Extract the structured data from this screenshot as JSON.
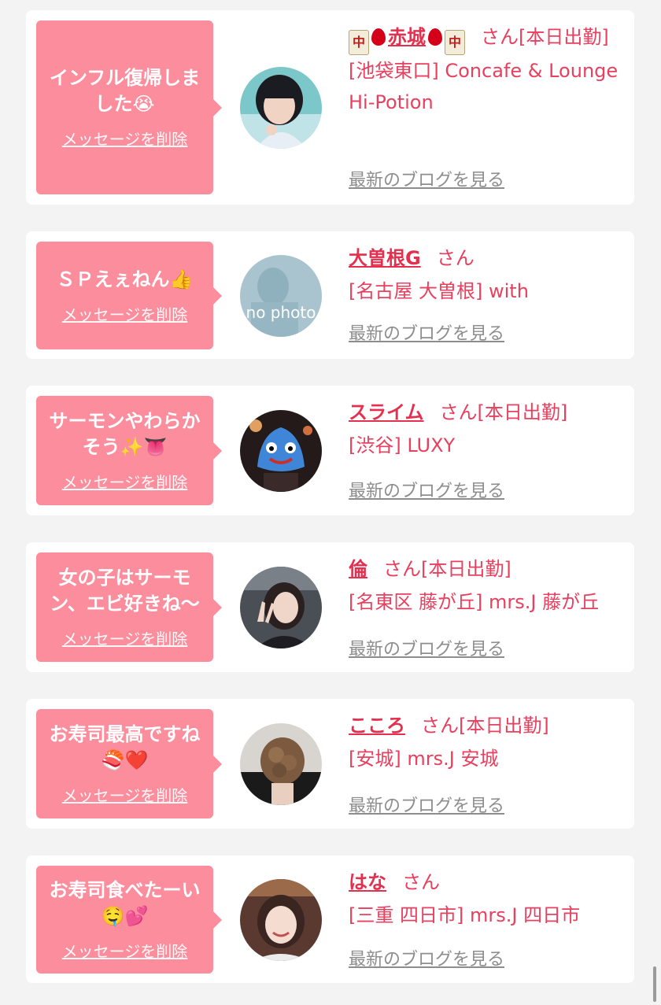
{
  "delete_label": "メッセージを削除",
  "blog_label": "最新のブログを見る",
  "san_label": "さん",
  "colors": {
    "bubble": "#fb8d9c",
    "accent": "#e3304f",
    "card": "#ffffff",
    "background": "#f3f3f3"
  },
  "cards": [
    {
      "message": "インフル復帰しました😭",
      "name": "赤城",
      "name_decor": [
        "mahjong-chun-icon",
        "blood-drop-icon"
      ],
      "status": "[本日出勤]",
      "shop": "[池袋東口] Concafe & Lounge Hi-Potion",
      "avatar": "photo-woman-short-black-hair"
    },
    {
      "message": "ＳＰえぇねん👍",
      "name": "大曽根G",
      "status": "",
      "shop": "[名古屋 大曽根] with",
      "avatar": "no photo"
    },
    {
      "message": "サーモンやわらかそう✨👅",
      "name": "スライム",
      "status": "[本日出勤]",
      "shop": "[渋谷] LUXY",
      "avatar": "photo-slime-mask"
    },
    {
      "message": "女の子はサーモン、エビ好きね〜",
      "name": "倫",
      "status": "[本日出勤]",
      "shop": "[名東区 藤が丘] mrs.J 藤が丘",
      "avatar": "photo-woman-peace-sign"
    },
    {
      "message": "お寿司最高ですね🍣❤️",
      "name": "こころ",
      "status": "[本日出勤]",
      "shop": "[安城] mrs.J 安城",
      "avatar": "photo-hair-updo"
    },
    {
      "message": "お寿司食べたーい🤤💕",
      "name": "はな",
      "status": "",
      "shop": "[三重 四日市] mrs.J 四日市",
      "avatar": "photo-woman-smiling"
    }
  ]
}
